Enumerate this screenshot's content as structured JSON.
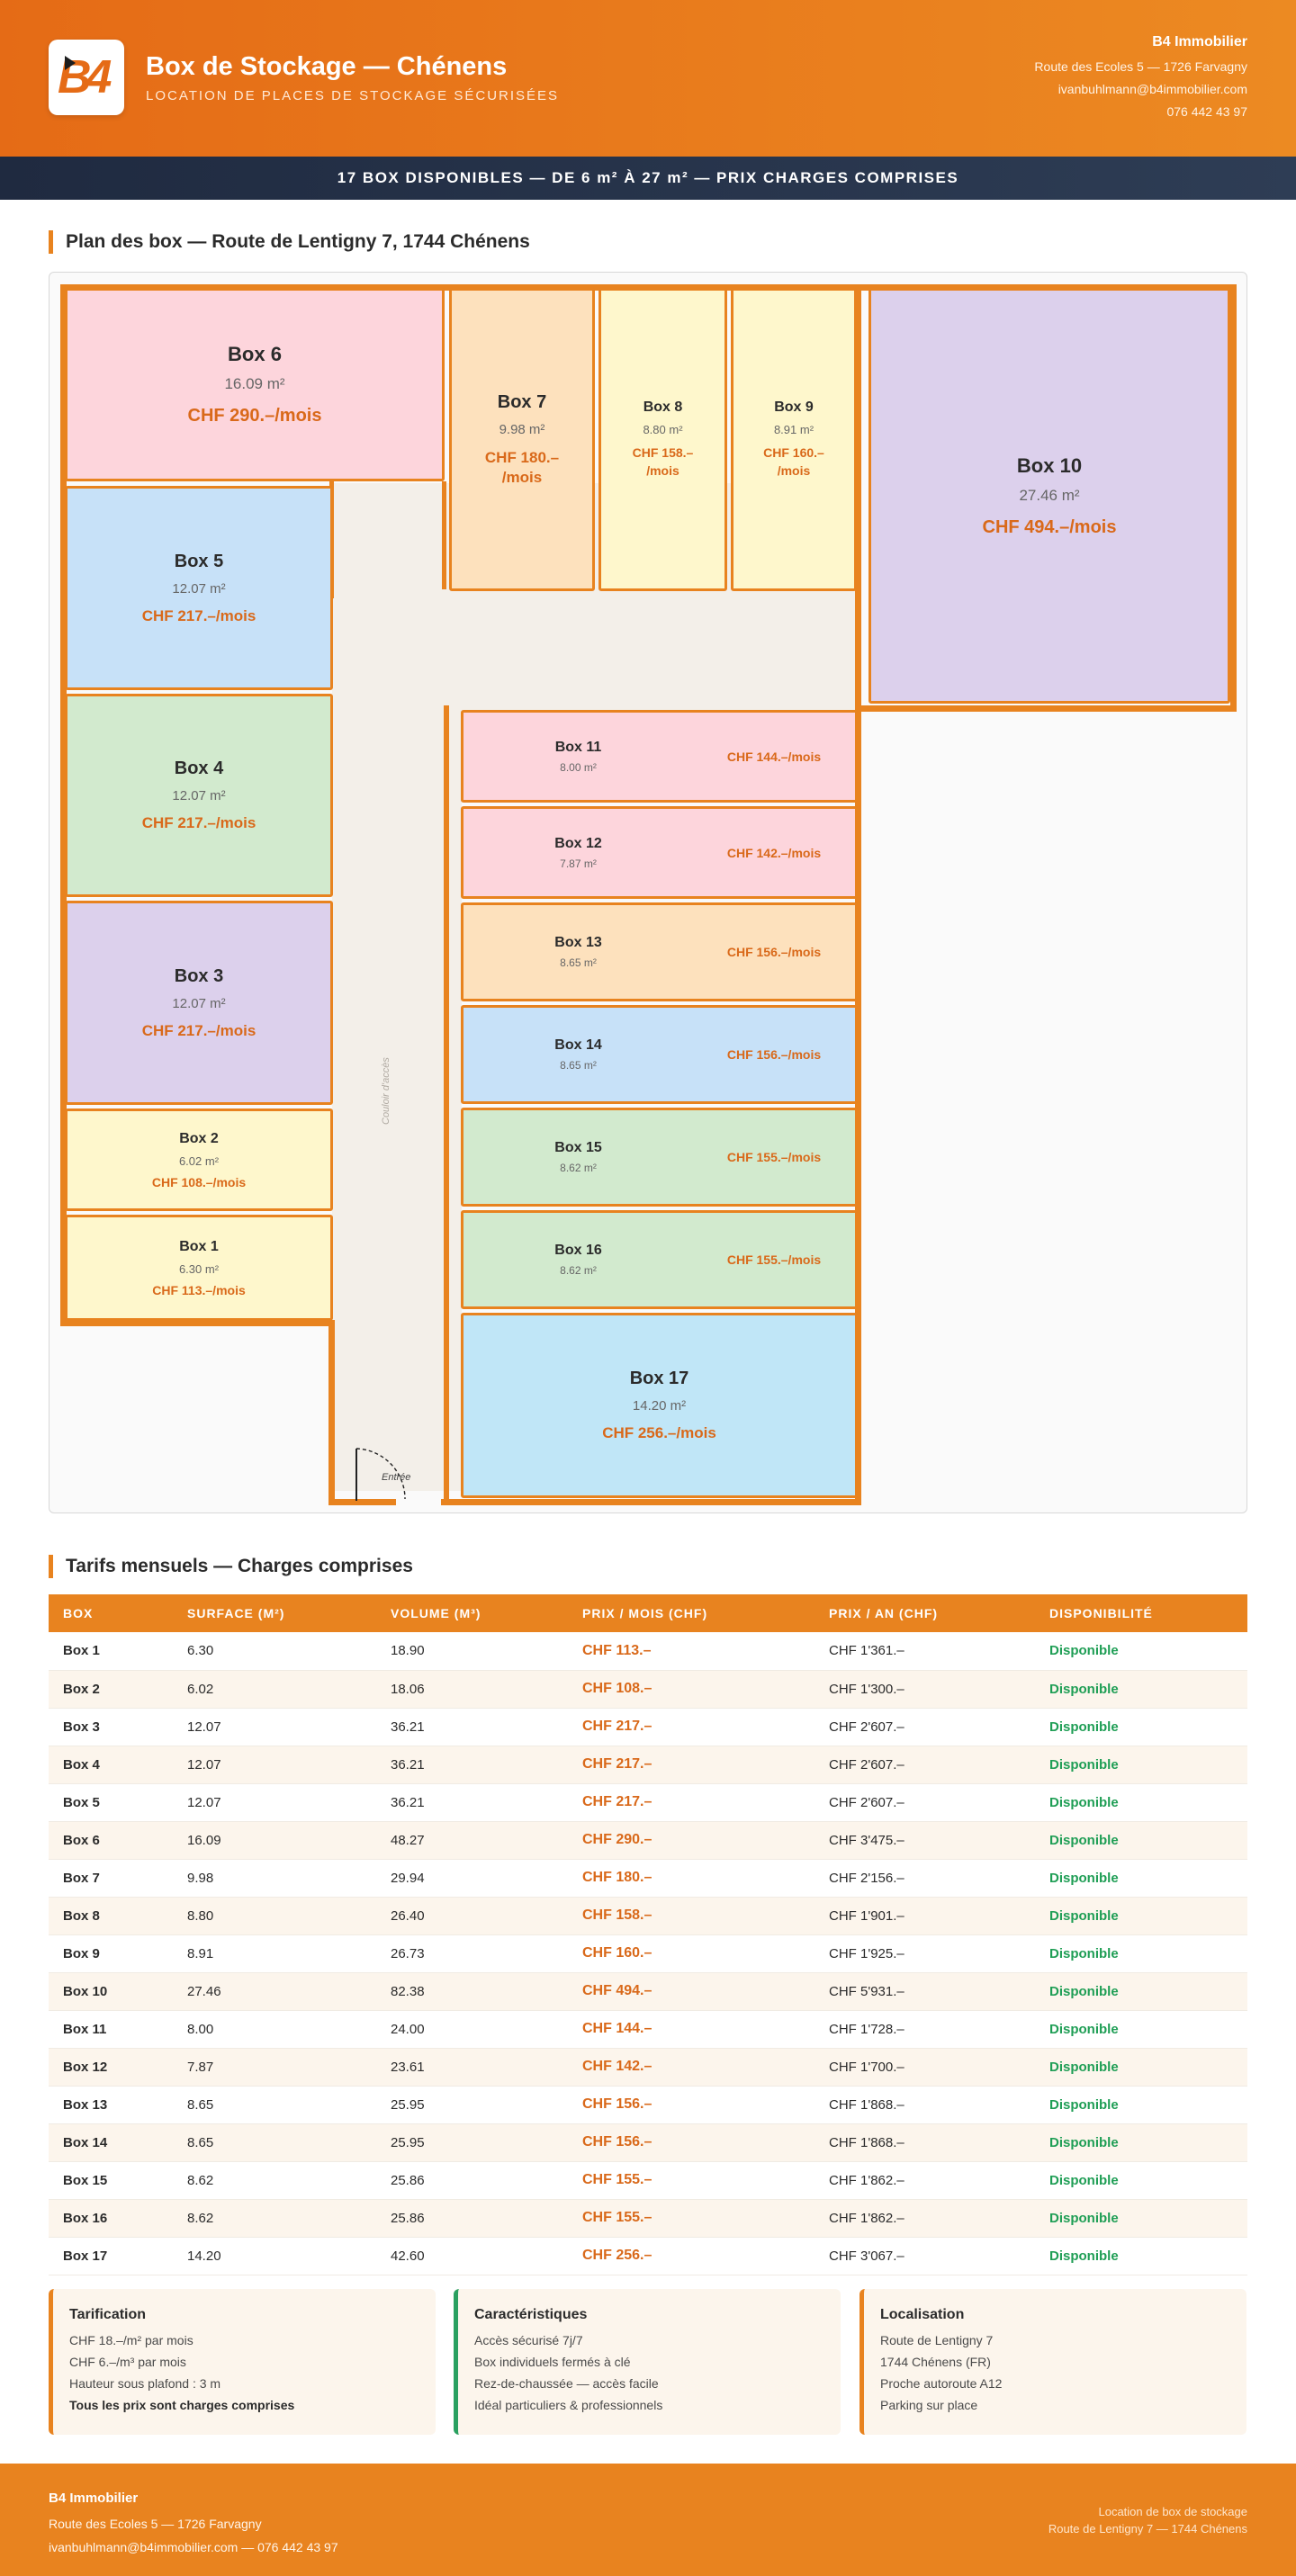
{
  "header": {
    "logo_text": "B4",
    "title": "Box de Stockage — Chénens",
    "subtitle": "LOCATION DE PLACES DE STOCKAGE SÉCURISÉES",
    "company": "B4 Immobilier",
    "address": "Route des Ecoles 5 — 1726 Farvagny",
    "email": "ivanbuhlmann@b4immobilier.com",
    "phone": "076 442 43 97"
  },
  "banner": "17 BOX DISPONIBLES — DE 6 m² À 27 m² — PRIX CHARGES COMPRISES",
  "plan": {
    "title": "Plan des box — Route de Lentigny 7, 1744 Chénens",
    "corridor_label": "Couloir d'accès",
    "entrance_label": "Entrée",
    "boxes": [
      {
        "name": "Box 1",
        "surface": "6.30 m²",
        "price": "CHF 113.–/mois"
      },
      {
        "name": "Box 2",
        "surface": "6.02 m²",
        "price": "CHF 108.–/mois"
      },
      {
        "name": "Box 3",
        "surface": "12.07 m²",
        "price": "CHF 217.–/mois"
      },
      {
        "name": "Box 4",
        "surface": "12.07 m²",
        "price": "CHF 217.–/mois"
      },
      {
        "name": "Box 5",
        "surface": "12.07 m²",
        "price": "CHF 217.–/mois"
      },
      {
        "name": "Box 6",
        "surface": "16.09 m²",
        "price": "CHF 290.–/mois"
      },
      {
        "name": "Box 7",
        "surface": "9.98 m²",
        "price": "CHF 180.–\n/mois"
      },
      {
        "name": "Box 8",
        "surface": "8.80 m²",
        "price": "CHF 158.–\n/mois"
      },
      {
        "name": "Box 9",
        "surface": "8.91 m²",
        "price": "CHF 160.–\n/mois"
      },
      {
        "name": "Box 10",
        "surface": "27.46 m²",
        "price": "CHF 494.–/mois"
      },
      {
        "name": "Box 11",
        "surface": "8.00 m²",
        "price": "CHF 144.–/mois"
      },
      {
        "name": "Box 12",
        "surface": "7.87 m²",
        "price": "CHF 142.–/mois"
      },
      {
        "name": "Box 13",
        "surface": "8.65 m²",
        "price": "CHF 156.–/mois"
      },
      {
        "name": "Box 14",
        "surface": "8.65 m²",
        "price": "CHF 156.–/mois"
      },
      {
        "name": "Box 15",
        "surface": "8.62 m²",
        "price": "CHF 155.–/mois"
      },
      {
        "name": "Box 16",
        "surface": "8.62 m²",
        "price": "CHF 155.–/mois"
      },
      {
        "name": "Box 17",
        "surface": "14.20 m²",
        "price": "CHF 256.–/mois"
      }
    ]
  },
  "tarifs": {
    "title": "Tarifs mensuels — Charges comprises",
    "columns": [
      "BOX",
      "SURFACE (M²)",
      "VOLUME (M³)",
      "PRIX / MOIS (CHF)",
      "PRIX / AN (CHF)",
      "DISPONIBILITÉ"
    ],
    "rows": [
      [
        "Box 1",
        "6.30",
        "18.90",
        "CHF 113.–",
        "CHF 1'361.–",
        "Disponible"
      ],
      [
        "Box 2",
        "6.02",
        "18.06",
        "CHF 108.–",
        "CHF 1'300.–",
        "Disponible"
      ],
      [
        "Box 3",
        "12.07",
        "36.21",
        "CHF 217.–",
        "CHF 2'607.–",
        "Disponible"
      ],
      [
        "Box 4",
        "12.07",
        "36.21",
        "CHF 217.–",
        "CHF 2'607.–",
        "Disponible"
      ],
      [
        "Box 5",
        "12.07",
        "36.21",
        "CHF 217.–",
        "CHF 2'607.–",
        "Disponible"
      ],
      [
        "Box 6",
        "16.09",
        "48.27",
        "CHF 290.–",
        "CHF 3'475.–",
        "Disponible"
      ],
      [
        "Box 7",
        "9.98",
        "29.94",
        "CHF 180.–",
        "CHF 2'156.–",
        "Disponible"
      ],
      [
        "Box 8",
        "8.80",
        "26.40",
        "CHF 158.–",
        "CHF 1'901.–",
        "Disponible"
      ],
      [
        "Box 9",
        "8.91",
        "26.73",
        "CHF 160.–",
        "CHF 1'925.–",
        "Disponible"
      ],
      [
        "Box 10",
        "27.46",
        "82.38",
        "CHF 494.–",
        "CHF 5'931.–",
        "Disponible"
      ],
      [
        "Box 11",
        "8.00",
        "24.00",
        "CHF 144.–",
        "CHF 1'728.–",
        "Disponible"
      ],
      [
        "Box 12",
        "7.87",
        "23.61",
        "CHF 142.–",
        "CHF 1'700.–",
        "Disponible"
      ],
      [
        "Box 13",
        "8.65",
        "25.95",
        "CHF 156.–",
        "CHF 1'868.–",
        "Disponible"
      ],
      [
        "Box 14",
        "8.65",
        "25.95",
        "CHF 156.–",
        "CHF 1'868.–",
        "Disponible"
      ],
      [
        "Box 15",
        "8.62",
        "25.86",
        "CHF 155.–",
        "CHF 1'862.–",
        "Disponible"
      ],
      [
        "Box 16",
        "8.62",
        "25.86",
        "CHF 155.–",
        "CHF 1'862.–",
        "Disponible"
      ],
      [
        "Box 17",
        "14.20",
        "42.60",
        "CHF 256.–",
        "CHF 3'067.–",
        "Disponible"
      ]
    ]
  },
  "cards": [
    {
      "title": "Tarification",
      "lines": [
        "CHF 18.–/m² par mois",
        "CHF 6.–/m³ par mois",
        "Hauteur sous plafond : 3 m",
        "Tous les prix sont charges comprises"
      ]
    },
    {
      "title": "Caractéristiques",
      "lines": [
        "Accès sécurisé 7j/7",
        "Box individuels fermés à clé",
        "Rez-de-chaussée — accès facile",
        "Idéal particuliers & professionnels"
      ]
    },
    {
      "title": "Localisation",
      "lines": [
        "Route de Lentigny 7",
        "1744 Chénens (FR)",
        "Proche autoroute A12",
        "Parking sur place"
      ]
    }
  ],
  "colors": {
    "accent": "#e8831f",
    "green_border": "#2aa060",
    "price": "#d9691a",
    "available": "#1f9e55"
  },
  "footer": {
    "company": "B4 Immobilier",
    "address": "Route des Ecoles 5 — 1726 Farvagny",
    "contact": "ivanbuhlmann@b4immobilier.com — 076 442 43 97",
    "right1": "Location de box de stockage",
    "right2": "Route de Lentigny 7 — 1744 Chénens"
  }
}
